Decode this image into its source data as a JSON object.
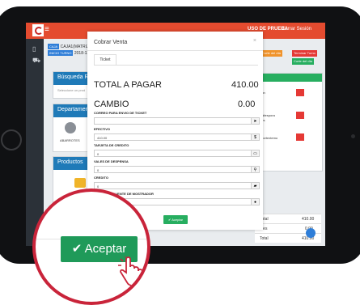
{
  "app": {
    "user_label": "USO DE PRUEBA",
    "logout_label": "Cerrar Sesión"
  },
  "caja": {
    "caja_label": "CAJA",
    "caja_value": "CAJA1(MATRIZ)",
    "turno_label": "INICIO TURNO",
    "turno_value": "2018-11-"
  },
  "top_buttons": {
    "orange": "Corte del día",
    "red": "Terminar Turno",
    "green": "Corte del día"
  },
  "panels": {
    "busqueda": "Búsqueda Rápida",
    "busqueda_placeholder": "Seleccione un prod",
    "departamentos": "Departamentos",
    "abarrotes": "ABARROTES",
    "abarrotes2": "Acc",
    "productos": "Productos"
  },
  "right_list": [
    "...on",
    "...nitespora",
    "...es",
    "...cortextemo"
  ],
  "totals": [
    {
      "label": "Total",
      "value": "410.00"
    },
    {
      "label": "ntes",
      "value": "0.00"
    },
    {
      "label": "Total",
      "value": "410.00"
    }
  ],
  "modal": {
    "title": "Cobrar Venta",
    "close": "×",
    "tab": "Ticket",
    "total_label": "TOTAL A PAGAR",
    "total_value": "410.00",
    "cambio_label": "CAMBIO",
    "cambio_value": "0.00",
    "fields": [
      {
        "label": "CORREO PARA ENVIO DE TICKET",
        "value": "",
        "addon": "send-icon"
      },
      {
        "label": "EFECTIVO",
        "value": "410.00",
        "addon": "$"
      },
      {
        "label": "TARJETA DE CREDITO",
        "value": "0",
        "addon": "card-icon"
      },
      {
        "label": "VALES DE DESPENSA",
        "value": "0",
        "addon": "tag-icon"
      },
      {
        "label": "CREDITO",
        "value": "0",
        "addon": "folder-icon"
      },
      {
        "label": "CREDITO A CLIENTE DE MOSTRADOR",
        "value": "",
        "addon": "user-icon"
      }
    ],
    "accept_small": "✔ Aceptar"
  },
  "zoom": {
    "accept_big": "✔ Aceptar"
  },
  "colors": {
    "brand": "#e44b2f",
    "accent": "#1f7ab8",
    "success": "#27ae60",
    "ring": "#c9243a"
  }
}
